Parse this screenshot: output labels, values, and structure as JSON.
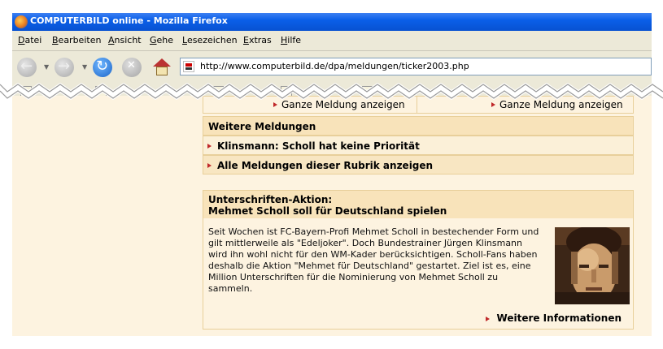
{
  "window": {
    "title": "COMPUTERBILD online - Mozilla Firefox"
  },
  "menu": [
    {
      "pre": "",
      "key": "D",
      "post": "atei"
    },
    {
      "pre": "",
      "key": "B",
      "post": "earbeiten"
    },
    {
      "pre": "",
      "key": "A",
      "post": "nsicht"
    },
    {
      "pre": "",
      "key": "G",
      "post": "ehe"
    },
    {
      "pre": "",
      "key": "L",
      "post": "esezeichen"
    },
    {
      "pre": "",
      "key": "E",
      "post": "xtras"
    },
    {
      "pre": "",
      "key": "H",
      "post": "ilfe"
    }
  ],
  "toolbar": {
    "url": "http://www.computerbild.de/dpa/meldungen/ticker2003.php"
  },
  "content": {
    "top_left": "Ganze Meldung anzeigen",
    "top_right": "Ganze Meldung anzeigen",
    "more_heading": "Weitere Meldungen",
    "link1": "Klinsmann: Scholl hat keine Priorität",
    "link2": "Alle Meldungen dieser Rubrik anzeigen",
    "box": {
      "title_line1": "Unterschriften-Aktion:",
      "title_line2": "Mehmet Scholl soll für Deutschland spielen",
      "body": "Seit Wochen ist FC-Bayern-Profi Mehmet Scholl in bestechender Form und gilt mittlerweile als \"Edeljoker\". Doch Bundestrainer Jürgen Klinsmann wird ihn wohl nicht für den WM-Kader berücksichtigen. Scholl-Fans haben deshalb die Aktion \"Mehmet für Deutschland\" gestartet. Ziel ist es, eine Million Unterschriften für die Nominierung von Mehmet Scholl zu sammeln.",
      "more": "Weitere Informationen"
    }
  },
  "colors": {
    "page_bg": "#fdf3e0",
    "row_bg": "#f8e6c2",
    "border": "#e8cf9a",
    "arrow": "#c0282a",
    "titlebar": "#0a5fe8"
  }
}
